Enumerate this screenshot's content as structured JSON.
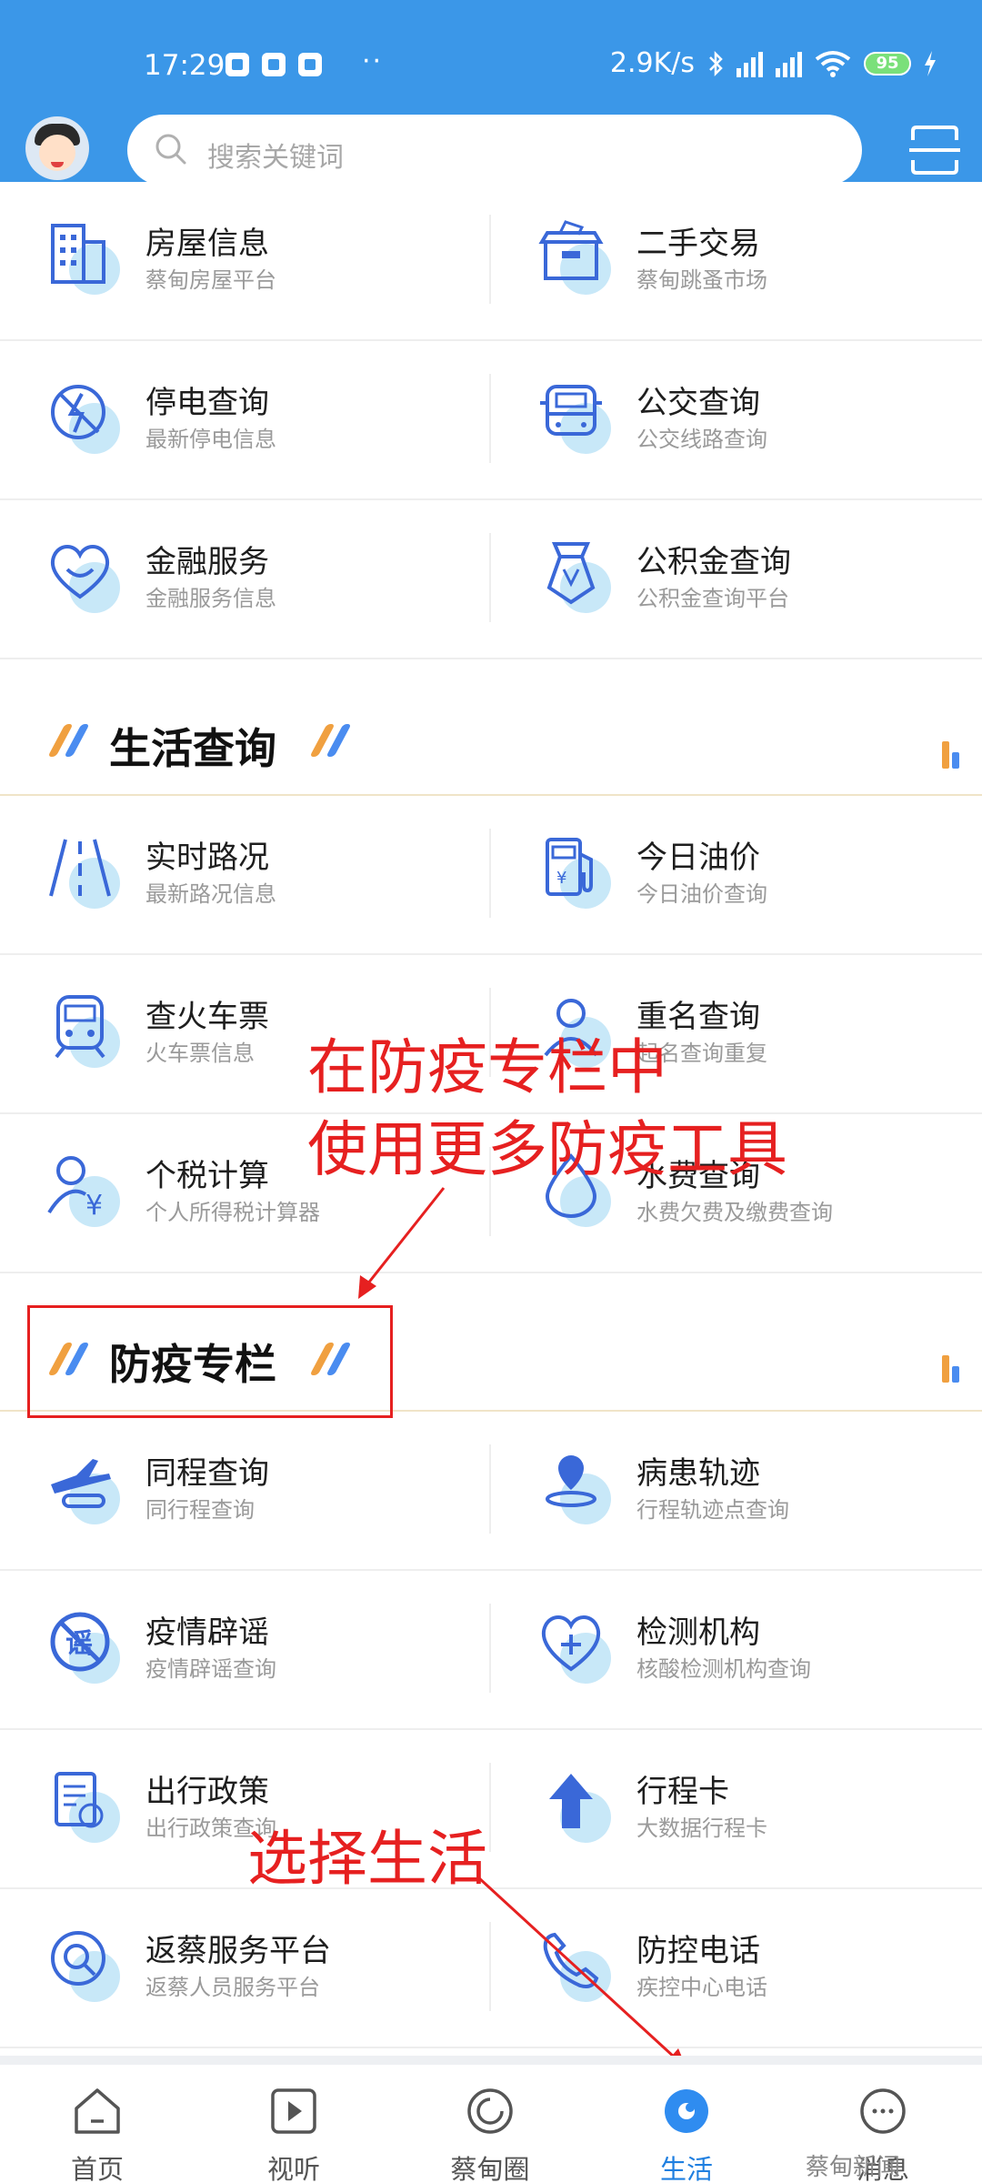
{
  "status_bar": {
    "time": "17:29",
    "dots": "··",
    "net_speed": "2.9K/s",
    "battery": "95"
  },
  "search": {
    "placeholder": "搜索关键词"
  },
  "colors": {
    "header": "#3b97e8",
    "accent": "#3a78e0",
    "annotation": "#e62020"
  },
  "top_rows": [
    {
      "left": {
        "title": "房屋信息",
        "sub": "蔡甸房屋平台",
        "icon": "building-icon"
      },
      "right": {
        "title": "二手交易",
        "sub": "蔡甸跳蚤市场",
        "icon": "box-icon"
      }
    },
    {
      "left": {
        "title": "停电查询",
        "sub": "最新停电信息",
        "icon": "power-off-icon"
      },
      "right": {
        "title": "公交查询",
        "sub": "公交线路查询",
        "icon": "bus-icon"
      }
    },
    {
      "left": {
        "title": "金融服务",
        "sub": "金融服务信息",
        "icon": "heart-smile-icon"
      },
      "right": {
        "title": "公积金查询",
        "sub": "公积金查询平台",
        "icon": "bag-icon"
      }
    }
  ],
  "sections": [
    {
      "title": "生活查询"
    },
    {
      "title": "防疫专栏"
    }
  ],
  "life_rows": [
    {
      "left": {
        "title": "实时路况",
        "sub": "最新路况信息",
        "icon": "road-icon"
      },
      "right": {
        "title": "今日油价",
        "sub": "今日油价查询",
        "icon": "fuel-icon"
      }
    },
    {
      "left": {
        "title": "查火车票",
        "sub": "火车票信息",
        "icon": "train-icon"
      },
      "right": {
        "title": "重名查询",
        "sub": "起名查询重复",
        "icon": "person-icon"
      }
    },
    {
      "left": {
        "title": "个税计算",
        "sub": "个人所得税计算器",
        "icon": "tax-person-icon"
      },
      "right": {
        "title": "水费查询",
        "sub": "水费欠费及缴费查询",
        "icon": "water-drop-icon"
      }
    }
  ],
  "epidemic_rows": [
    {
      "left": {
        "title": "同程查询",
        "sub": "同行程查询",
        "icon": "plane-train-icon"
      },
      "right": {
        "title": "病患轨迹",
        "sub": "行程轨迹点查询",
        "icon": "location-pin-icon"
      }
    },
    {
      "left": {
        "title": "疫情辟谣",
        "sub": "疫情辟谣查询",
        "icon": "rumor-icon"
      },
      "right": {
        "title": "检测机构",
        "sub": "核酸检测机构查询",
        "icon": "heart-plus-icon"
      }
    },
    {
      "left": {
        "title": "出行政策",
        "sub": "出行政策查询",
        "icon": "document-icon"
      },
      "right": {
        "title": "行程卡",
        "sub": "大数据行程卡",
        "icon": "arrow-up-icon"
      }
    },
    {
      "left": {
        "title": "返蔡服务平台",
        "sub": "返蔡人员服务平台",
        "icon": "magnifier-icon"
      },
      "right": {
        "title": "防控电话",
        "sub": "疾控中心电话",
        "icon": "phone-icon"
      }
    }
  ],
  "annotations": {
    "line1": "在防疫专栏中",
    "line2": "使用更多防疫工具",
    "line3": "选择生活"
  },
  "nav": [
    {
      "label": "首页",
      "icon": "home-icon"
    },
    {
      "label": "视听",
      "icon": "play-icon"
    },
    {
      "label": "蔡甸圈",
      "icon": "circle-icon"
    },
    {
      "label": "生活",
      "icon": "life-icon",
      "active": true
    },
    {
      "label": "消息",
      "icon": "message-icon"
    }
  ],
  "watermark": "蔡甸新闻"
}
